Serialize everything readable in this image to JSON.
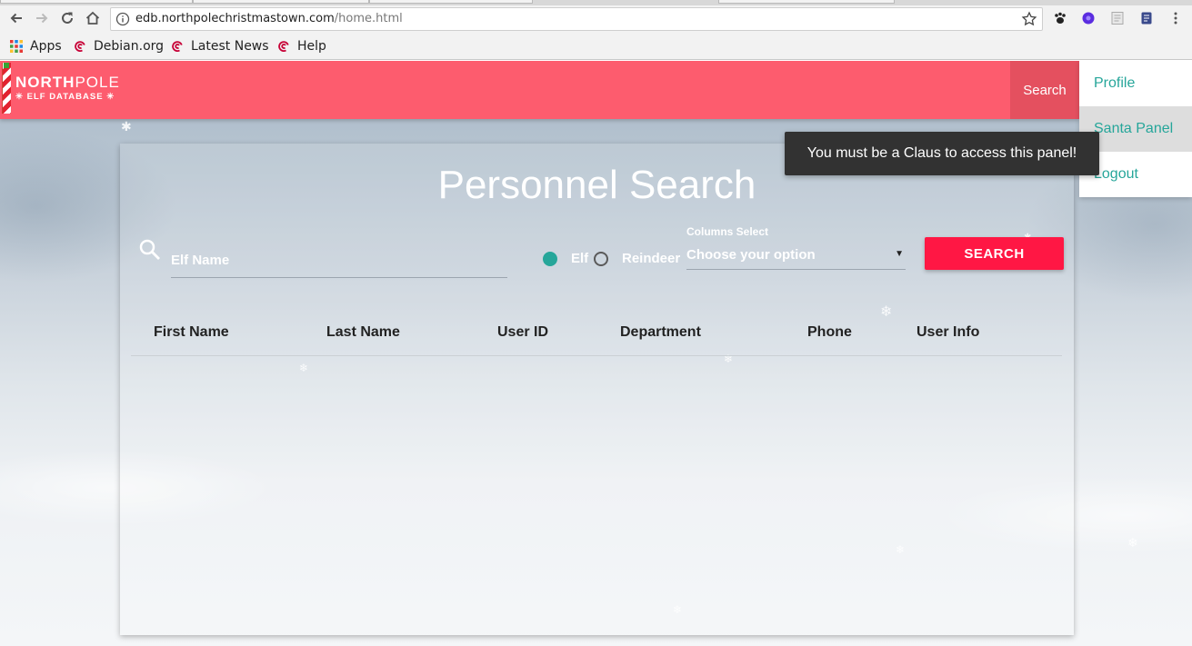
{
  "browser": {
    "url_host": "edb.northpolechristmastown.com",
    "url_path": "/home.html",
    "bookmarks": [
      {
        "label": "Apps",
        "icon": "apps-grid-icon"
      },
      {
        "label": "Debian.org",
        "icon": "debian-icon"
      },
      {
        "label": "Latest News",
        "icon": "debian-icon"
      },
      {
        "label": "Help",
        "icon": "debian-icon"
      }
    ]
  },
  "header": {
    "logo_line1_bold": "NORTH",
    "logo_line1_light": "POLE",
    "logo_line2": "ELF DATABASE",
    "search_label": "Search",
    "brand_color": "#fd5c6e"
  },
  "menu": {
    "items": [
      {
        "label": "Profile"
      },
      {
        "label": "Santa Panel",
        "active": true
      },
      {
        "label": "Logout"
      }
    ],
    "link_color": "#26a69a"
  },
  "toast": {
    "message": "You must be a Claus to access this panel!"
  },
  "search": {
    "title": "Personnel Search",
    "name_placeholder": "Elf Name",
    "radio_options": [
      {
        "label": "Elf",
        "selected": true
      },
      {
        "label": "Reindeer",
        "selected": false
      }
    ],
    "columns_label": "Columns Select",
    "columns_value": "Choose your option",
    "button_label": "SEARCH",
    "button_color": "#ff1744"
  },
  "table": {
    "columns": [
      "First Name",
      "Last Name",
      "User ID",
      "Department",
      "Phone",
      "User Info"
    ],
    "rows": []
  }
}
